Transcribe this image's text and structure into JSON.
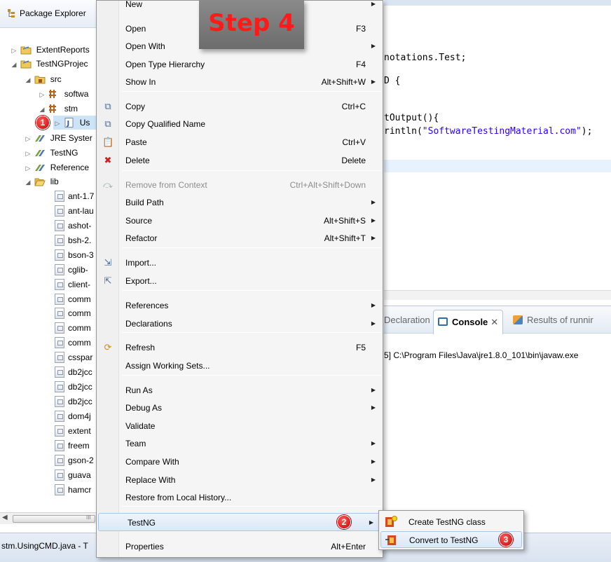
{
  "package_explorer": {
    "title": "Package Explorer",
    "items": [
      {
        "label": "ExtentReports",
        "icon": "folder-icon",
        "twisty": "▷"
      },
      {
        "label": "TestNGProjec",
        "icon": "folder-icon",
        "twisty": "◢"
      },
      {
        "label": "src",
        "icon": "source-folder-icon",
        "twisty": "◢"
      },
      {
        "label": "softwa",
        "icon": "package-icon",
        "twisty": "▷"
      },
      {
        "label": "stm",
        "icon": "package-icon",
        "twisty": "◢"
      },
      {
        "label": "Us",
        "icon": "java-file-icon",
        "twisty": "▷"
      },
      {
        "label": "JRE Syster",
        "icon": "library-icon",
        "twisty": "▷"
      },
      {
        "label": "TestNG",
        "icon": "library-icon",
        "twisty": "▷"
      },
      {
        "label": "Reference",
        "icon": "library-icon",
        "twisty": "▷"
      },
      {
        "label": "lib",
        "icon": "folder-icon",
        "twisty": "◢"
      }
    ],
    "jars": [
      "ant-1.7",
      "ant-lau",
      "ashot-",
      "bsh-2.",
      "bson-3",
      "cglib-",
      "client-",
      "comm",
      "comm",
      "comm",
      "comm",
      "csspar",
      "db2jcc",
      "db2jcc",
      "db2jcc",
      "dom4j",
      "extent",
      "freem",
      "gson-2",
      "guava",
      "hamcr"
    ],
    "scroll_label": "III"
  },
  "status_bar": {
    "text": "stm.UsingCMD.java - T"
  },
  "step_banner": "Step 4",
  "badges": {
    "one": "1",
    "two": "2",
    "three": "3"
  },
  "editor": {
    "lines": [
      {
        "text": "notations.Test;"
      },
      {
        "text": "D {"
      },
      {
        "text": "tOutput(){"
      },
      {
        "prefix": "rintln(",
        "string": "\"SoftwareTestingMaterial.com\"",
        "suffix": ");"
      }
    ]
  },
  "views": {
    "tabs": [
      {
        "label": "Declaration"
      },
      {
        "label": "Console",
        "active": true
      },
      {
        "label": "Results of runnir"
      }
    ],
    "console_text": "5] C:\\Program Files\\Java\\jre1.8.0_101\\bin\\javaw.exe"
  },
  "context_menu": {
    "items": [
      {
        "label": "New",
        "shortcut": "",
        "submenu": true
      },
      {
        "label": "Open",
        "shortcut": "F3"
      },
      {
        "label": "Open With",
        "shortcut": "",
        "submenu": true
      },
      {
        "label": "Open Type Hierarchy",
        "shortcut": "F4"
      },
      {
        "label": "Show In",
        "shortcut": "Alt+Shift+W",
        "submenu": true
      },
      {
        "label": "Copy",
        "shortcut": "Ctrl+C",
        "icon": "copy-icon"
      },
      {
        "label": "Copy Qualified Name",
        "shortcut": "",
        "icon": "copy-qualified-icon"
      },
      {
        "label": "Paste",
        "shortcut": "Ctrl+V",
        "icon": "paste-icon"
      },
      {
        "label": "Delete",
        "shortcut": "Delete",
        "icon": "delete-icon"
      },
      {
        "label": "Remove from Context",
        "shortcut": "Ctrl+Alt+Shift+Down",
        "disabled": true,
        "icon": "remove-context-icon"
      },
      {
        "label": "Build Path",
        "shortcut": "",
        "submenu": true
      },
      {
        "label": "Source",
        "shortcut": "Alt+Shift+S",
        "submenu": true
      },
      {
        "label": "Refactor",
        "shortcut": "Alt+Shift+T",
        "submenu": true
      },
      {
        "label": "Import...",
        "shortcut": "",
        "icon": "import-icon"
      },
      {
        "label": "Export...",
        "shortcut": "",
        "icon": "export-icon"
      },
      {
        "label": "References",
        "shortcut": "",
        "submenu": true
      },
      {
        "label": "Declarations",
        "shortcut": "",
        "submenu": true
      },
      {
        "label": "Refresh",
        "shortcut": "F5",
        "icon": "refresh-icon"
      },
      {
        "label": "Assign Working Sets...",
        "shortcut": ""
      },
      {
        "label": "Run As",
        "shortcut": "",
        "submenu": true
      },
      {
        "label": "Debug As",
        "shortcut": "",
        "submenu": true
      },
      {
        "label": "Validate",
        "shortcut": ""
      },
      {
        "label": "Team",
        "shortcut": "",
        "submenu": true
      },
      {
        "label": "Compare With",
        "shortcut": "",
        "submenu": true
      },
      {
        "label": "Replace With",
        "shortcut": "",
        "submenu": true
      },
      {
        "label": "Restore from Local History...",
        "shortcut": ""
      },
      {
        "label": "TestNG",
        "shortcut": "",
        "submenu": true,
        "highlighted": true
      },
      {
        "label": "Properties",
        "shortcut": "Alt+Enter"
      }
    ]
  },
  "testng_submenu": {
    "items": [
      {
        "label": "Create TestNG class"
      },
      {
        "label": "Convert to TestNG",
        "highlighted": true
      }
    ]
  },
  "colors": {
    "badge": "#d40000",
    "step_text": "#ff1a1a",
    "string_literal": "#2a00ff"
  }
}
